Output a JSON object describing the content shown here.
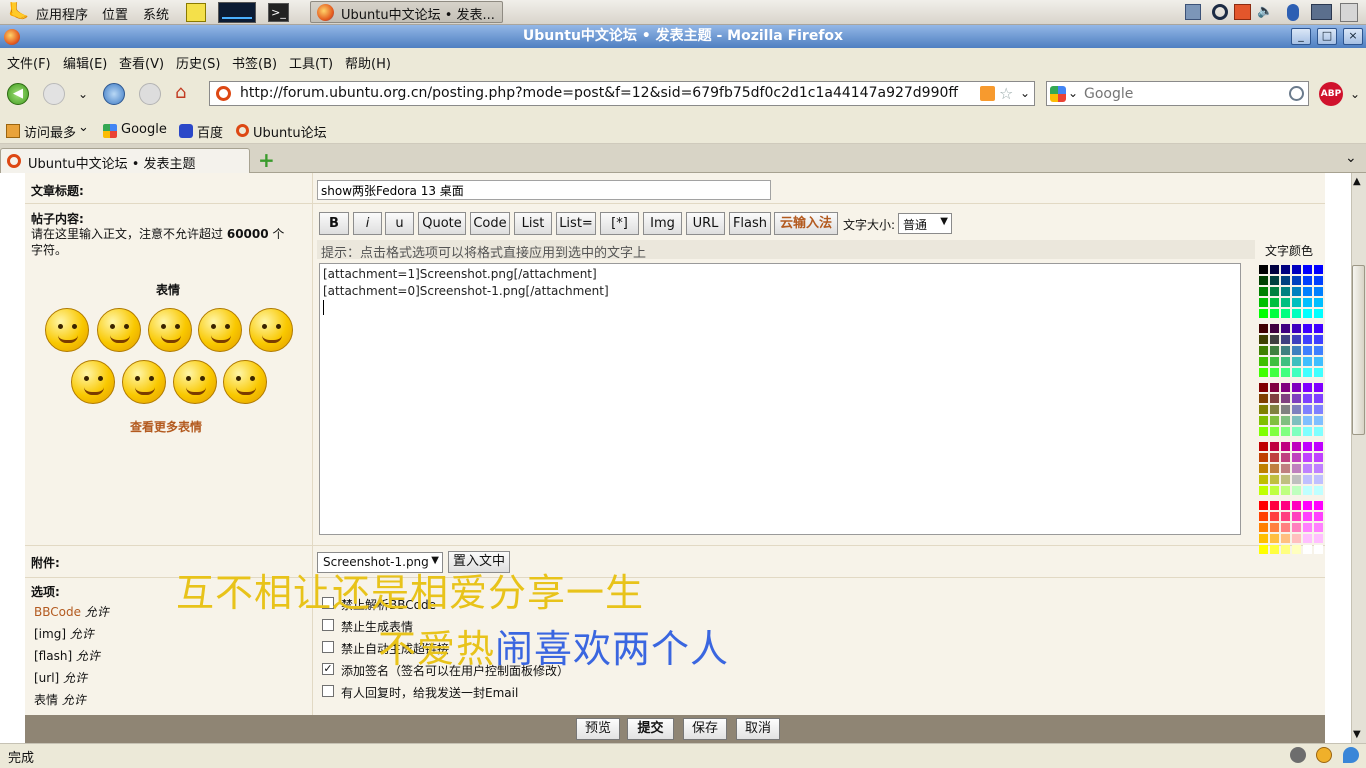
{
  "panel": {
    "apps": "应用程序",
    "places": "位置",
    "system": "系统",
    "task_label": "Ubuntu中文论坛 • 发表..."
  },
  "window": {
    "title": "Ubuntu中文论坛 • 发表主题 - Mozilla Firefox",
    "min": "_",
    "max": "□",
    "close": "×"
  },
  "menubar": [
    "文件(F)",
    "编辑(E)",
    "查看(V)",
    "历史(S)",
    "书签(B)",
    "工具(T)",
    "帮助(H)"
  ],
  "nav": {
    "url": "http://forum.ubuntu.org.cn/posting.php?mode=post&f=12&sid=679fb75df0c2d1c1a44147a927d990ff",
    "search_placeholder": "Google",
    "abp": "ABP"
  },
  "bookmarks": [
    "访问最多",
    "Google",
    "百度",
    "Ubuntu论坛"
  ],
  "tab": {
    "label": "Ubuntu中文论坛 • 发表主题",
    "new_tab": "+"
  },
  "form": {
    "subject_label": "文章标题:",
    "subject_value": "show两张Fedora 13 桌面",
    "content_label": "帖子内容:",
    "content_hint_pre": "请在这里输入正文，注意不允许超过",
    "content_hint_num": "60000",
    "content_hint_post": "个字符。",
    "emotes_title": "表情",
    "more_emotes": "查看更多表情",
    "toolbar": [
      "B",
      "i",
      "u",
      "Quote",
      "Code",
      "List",
      "List=",
      "[*]",
      "Img",
      "URL",
      "Flash"
    ],
    "cloud_input": "云输入法",
    "font_size_label": "文字大小:",
    "font_size_value": "普通",
    "tip": "提示：点击格式选项可以将格式直接应用到选中的文字上",
    "text_color_label": "文字颜色",
    "body_lines": [
      "[attachment=1]Screenshot.png[/attachment]",
      "[attachment=0]Screenshot-1.png[/attachment]"
    ],
    "attach_label": "附件:",
    "attach_select": "Screenshot-1.png",
    "attach_insert": "置入文中",
    "options_label": "选项:",
    "left_options": [
      {
        "name": "BBCode",
        "state": "允许"
      },
      {
        "name": "[img]",
        "state": "允许"
      },
      {
        "name": "[flash]",
        "state": "允许"
      },
      {
        "name": "[url]",
        "state": "允许"
      },
      {
        "name": "表情",
        "state": "允许"
      }
    ],
    "checkboxes": [
      {
        "label": "禁止解析BBCode",
        "checked": false
      },
      {
        "label": "禁止生成表情",
        "checked": false
      },
      {
        "label": "禁止自动生成超链接",
        "checked": false
      },
      {
        "label": "添加签名（签名可以在用户控制面板修改）",
        "checked": true
      },
      {
        "label": "有人回复时，给我发送一封Email",
        "checked": false
      }
    ],
    "buttons": [
      "预览",
      "提交",
      "保存",
      "取消"
    ]
  },
  "lyrics": {
    "line1": "互不相让还是相爱分享一生",
    "line2_part1": "不爱热",
    "line2_part2": "闹喜欢两个人"
  },
  "status": "完成"
}
